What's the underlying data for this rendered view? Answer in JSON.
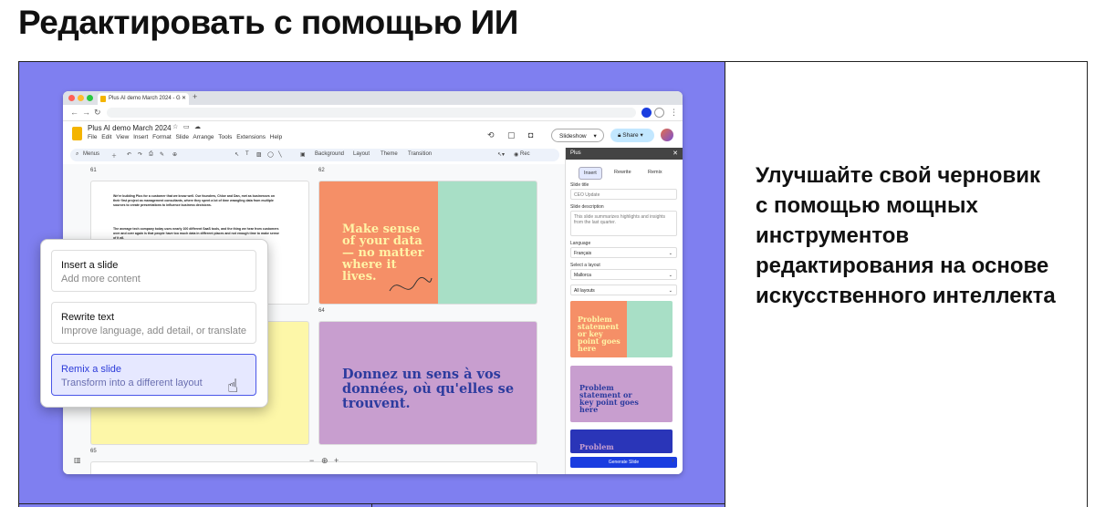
{
  "heading": "Редактировать с помощью ИИ",
  "description": "Улучшайте свой черновик с помощью мощных инструментов редактирования на основе искусственного интеллекта",
  "browser": {
    "tab_title": "Plus AI demo March 2024 - G",
    "doc_title": "Plus AI demo March 2024",
    "menus": "File Edit View Insert Format Slide Arrange Tools Extensions Help",
    "slideshow": "Slideshow",
    "share": "Share",
    "rec": "Rec",
    "toolbar": {
      "menus": "Menus",
      "background": "Background",
      "layout": "Layout",
      "theme": "Theme",
      "transition": "Transition"
    }
  },
  "slides": {
    "num_61": "61",
    "num_62": "62",
    "num_64": "64",
    "num_65": "65",
    "slide61_para1": "We're building Plus for a customer that we know well. Our founders, Chloe and Dan, met as businesses on their first project as management consultants, where they spent a lot of time wrangling data from multiple sources to create presentations to influence business decisions.",
    "slide61_para2": "The average tech company today uses nearly 100 different SaaS tools, and the thing we hear from customers over and over again is that people have too much data in different places and not enough time to make sense of it all.",
    "slide62_heading": "Make sense of your data — no matter where it lives.",
    "slide64_heading": "Donnez un sens à vos données, où qu'elles se trouvent."
  },
  "popup": {
    "options": [
      {
        "title": "Insert a slide",
        "subtitle": "Add more content"
      },
      {
        "title": "Rewrite text",
        "subtitle": "Improve language, add detail, or translate"
      },
      {
        "title": "Remix a slide",
        "subtitle": "Transform into a different layout"
      }
    ]
  },
  "panel": {
    "title": "Plus",
    "tabs": [
      "Insert",
      "Rewrite",
      "Remix"
    ],
    "slide_title_label": "Slide title",
    "slide_title_value": "CEO Update",
    "slide_desc_label": "Slide description",
    "slide_desc_placeholder": "This slide summarizes highlights and insights from the last quarter.",
    "language_label": "Language",
    "language_value": "Français",
    "layout_label": "Select a layout",
    "layout_value": "Mallorca",
    "layouts_filter": "All layouts",
    "thumb1_text": "Problem statement or key point goes here",
    "thumb2_text": "Problem statement or key point goes here",
    "thumb3_text": "Problem",
    "generate": "Generate Slide"
  },
  "colors": {
    "purple_bg": "#7f7ff0",
    "slide_orange": "#f58f67",
    "slide_mint": "#a8dfc6",
    "slide_yellow": "#fdf7a8",
    "slide_lilac": "#c89ecf",
    "accent_blue": "#2c3bd9"
  }
}
